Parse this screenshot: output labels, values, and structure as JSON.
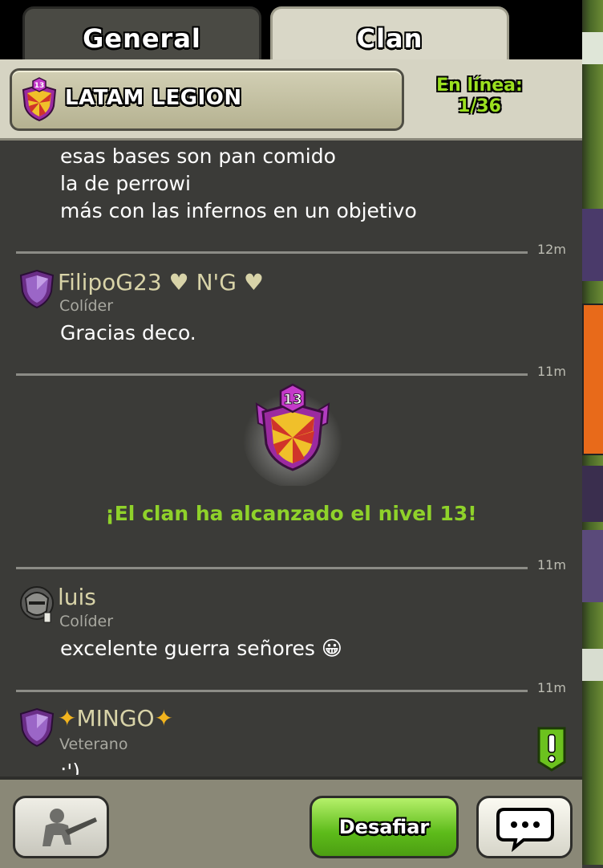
{
  "tabs": {
    "general": "General",
    "clan": "Clan"
  },
  "header": {
    "clan_name": "LATAM LEGION",
    "clan_level": "13",
    "online_label": "En línea:",
    "online_count": "1/36"
  },
  "chat": {
    "first_message_lines": [
      "esas bases son pan comido",
      "la de perrowi",
      "más con las infernos en un objetivo"
    ],
    "time_1": "12m",
    "msg2": {
      "name": "FilipoG23",
      "name_suffix": "N'G",
      "role": "Colíder",
      "text": "Gracias deco."
    },
    "time_2": "11m",
    "level_up": {
      "badge_level": "13",
      "text": "¡El clan ha alcanzado el nivel  13!"
    },
    "time_3": "11m",
    "msg3": {
      "name": "luis",
      "role": "Colíder",
      "text": "excelente guerra señores 😀"
    },
    "time_4": "11m",
    "msg4": {
      "name": "MINGO",
      "role": "Veterano",
      "text": ":')"
    }
  },
  "bottom": {
    "challenge_label": "Desafiar"
  },
  "colors": {
    "online_green": "#9be01f",
    "levelup_green": "#8fd22a",
    "username": "#d8d3a8"
  },
  "icons": [
    "clan-badge-icon",
    "league-shield-icon",
    "knight-avatar-icon",
    "sparkle-icon",
    "heart-icon",
    "alert-icon",
    "war-icon",
    "chat-bubble-icon"
  ]
}
